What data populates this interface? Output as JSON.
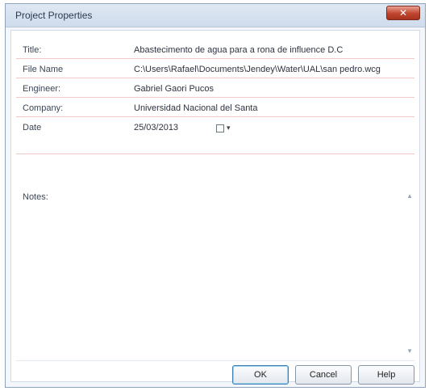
{
  "window": {
    "title": "Project Properties",
    "close_label": "✕"
  },
  "fields": [
    {
      "label": "Title:",
      "value": "Abastecimento de agua para a rona de influence D.C"
    },
    {
      "label": "File Name",
      "value": "C:\\Users\\Rafael\\Documents\\Jendey\\Water\\UAL\\san pedro.wcg"
    },
    {
      "label": "Engineer:",
      "value": "Gabriel Gaori Pucos"
    },
    {
      "label": "Company:",
      "value": "Universidad Nacional del Santa"
    },
    {
      "label": "Date",
      "value": "25/03/2013"
    }
  ],
  "date_picker": {
    "arrow": "▾"
  },
  "notes": {
    "label": "Notes:",
    "value": ""
  },
  "buttons": {
    "ok": "OK",
    "cancel": "Cancel",
    "help": "Help"
  }
}
